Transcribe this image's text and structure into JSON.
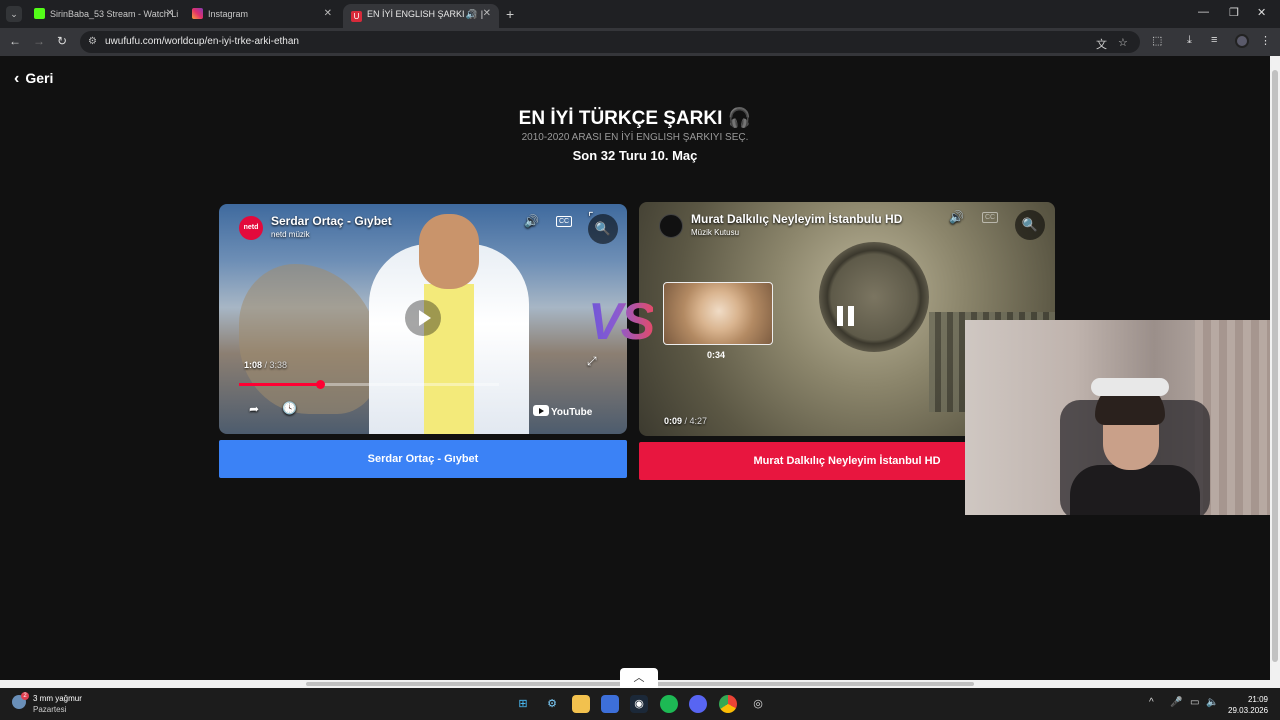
{
  "browser": {
    "tabs": [
      {
        "title": "SirinBaba_53 Stream - Watch Li",
        "active": false
      },
      {
        "title": "Instagram",
        "active": false
      },
      {
        "title": "EN İYİ ENGLISH ŞARKI 🎧 |",
        "active": true
      }
    ],
    "url": "uwufufu.com/worldcup/en-iyi-trke-arki-ethan"
  },
  "page": {
    "back_label": "Geri",
    "title": "EN İYİ TÜRKÇE ŞARKI 🎧",
    "subtitle": "2010-2020 ARASI EN İYİ ENGLISH ŞARKIYI SEÇ.",
    "round_label": "Son 32 Turu 10. Maç",
    "vs_label": "VS"
  },
  "left_video": {
    "title": "Serdar Ortaç - Gıybet",
    "channel": "netd müzik",
    "logo_text": "netd",
    "current_time": "1:08",
    "duration": "3:38",
    "progress": 0.31,
    "platform": "YouTube",
    "choose_label": "Serdar Ortaç - Gıybet"
  },
  "right_video": {
    "title": "Murat Dalkılıç Neyleyim İstanbulu HD",
    "channel": "Müzik Kutusu",
    "current_time": "0:09",
    "duration": "4:27",
    "preview_time": "0:34",
    "progress": 0.04,
    "choose_label": "Murat Dalkılıç Neyleyim İstanbul HD"
  },
  "taskbar": {
    "weather_text": "3 mm yağmur",
    "weather_sub": "Pazartesi",
    "weather_badge": "2",
    "time": "21:09",
    "date": "29.03.2026"
  },
  "colors": {
    "left_button": "#3b82f6",
    "right_button": "#e8163f",
    "progress": "#ff0033"
  }
}
